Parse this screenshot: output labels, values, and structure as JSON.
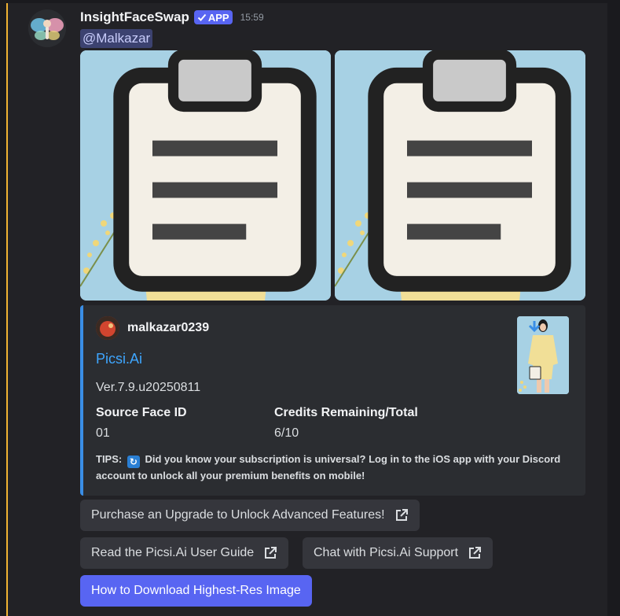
{
  "message": {
    "username": "InsightFaceSwap",
    "app_badge": "APP",
    "timestamp": "15:59",
    "mention": "@Malkazar",
    "avatar_icon": "butterfly-fairy-avatar"
  },
  "attachments": [
    {
      "alt": "woman-in-yellow-suit-photo",
      "download_icon": "arrow-down-icon",
      "clip_icon": "clipboard-icon"
    },
    {
      "alt": "woman-in-yellow-suit-photo",
      "download_icon": "arrow-down-icon",
      "clip_icon": "clipboard-icon"
    }
  ],
  "embed": {
    "accent_color": "#3a8ee6",
    "author": "malkazar0239",
    "title": "Picsi.Ai",
    "description": "Ver.7.9.u20250811",
    "fields": [
      {
        "name": "Source Face ID",
        "value": "01"
      },
      {
        "name": "Credits Remaining/Total",
        "value": "6/10"
      }
    ],
    "tips_prefix": "TIPS:",
    "tips_text": "Did you know your subscription is universal? Log in to the iOS app with your Discord account to unlock all your premium benefits on mobile!"
  },
  "buttons": {
    "upgrade": "Purchase an Upgrade to Unlock Advanced Features!",
    "guide": "Read the Picsi.Ai User Guide",
    "support": "Chat with Picsi.Ai Support",
    "download": "How to Download Highest-Res Image"
  },
  "colors": {
    "brand": "#5865f2",
    "link": "#3ea6ff",
    "background": "#222226"
  }
}
